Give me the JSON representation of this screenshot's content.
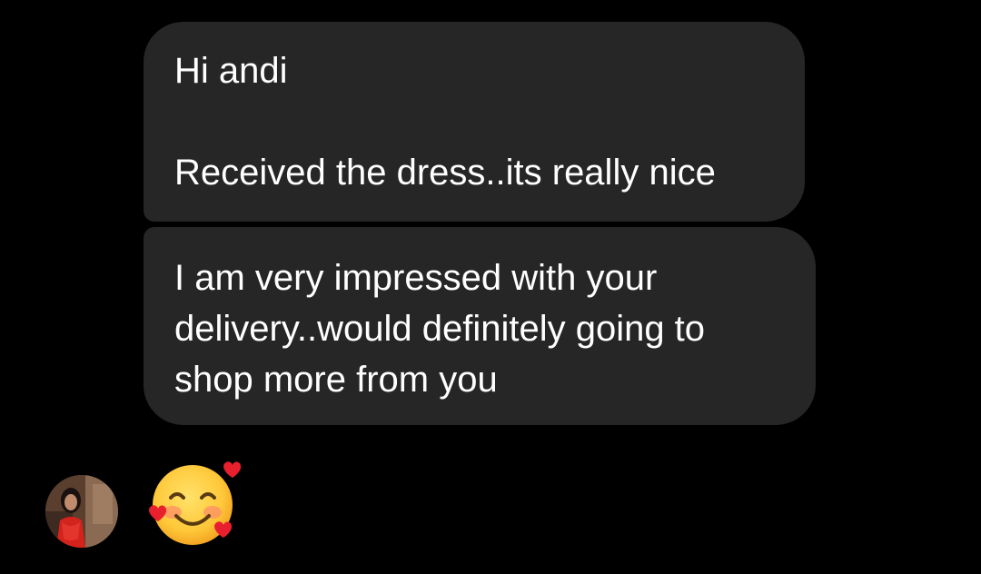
{
  "messages": [
    {
      "text": "Hi andi\n\nReceived the dress..its really nice"
    },
    {
      "text": "I am very impressed with your\ndelivery..would definitely going to\nshop more from you"
    }
  ],
  "reaction": {
    "icon": "smiling-face-with-hearts-icon"
  },
  "colors": {
    "background": "#000000",
    "bubble": "#262626",
    "text": "#ffffff"
  }
}
